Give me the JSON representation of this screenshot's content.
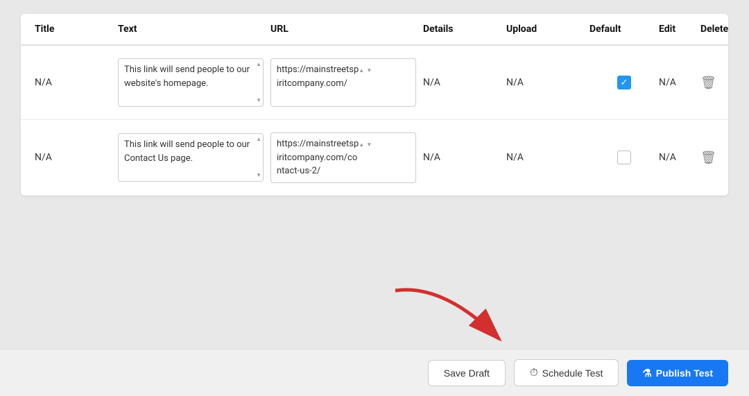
{
  "table": {
    "headers": {
      "title": "Title",
      "text": "Text",
      "url": "URL",
      "details": "Details",
      "upload": "Upload",
      "default": "Default",
      "edit": "Edit",
      "delete": "Delete"
    },
    "rows": [
      {
        "title": "N/A",
        "text": "This link will send people to our website's homepage.",
        "url": "https://mainstreetsp iritcompany.com/",
        "details": "N/A",
        "upload": "N/A",
        "default_checked": true,
        "edit": "N/A"
      },
      {
        "title": "N/A",
        "text": "This link will send people to our Contact Us page.",
        "url": "https://mainstreetsp iritcompany.com/co ntact-us-2/",
        "details": "N/A",
        "upload": "N/A",
        "default_checked": false,
        "edit": "N/A"
      }
    ]
  },
  "footer": {
    "save_draft_label": "Save Draft",
    "schedule_label": "Schedule Test",
    "publish_label": "Publish Test"
  }
}
